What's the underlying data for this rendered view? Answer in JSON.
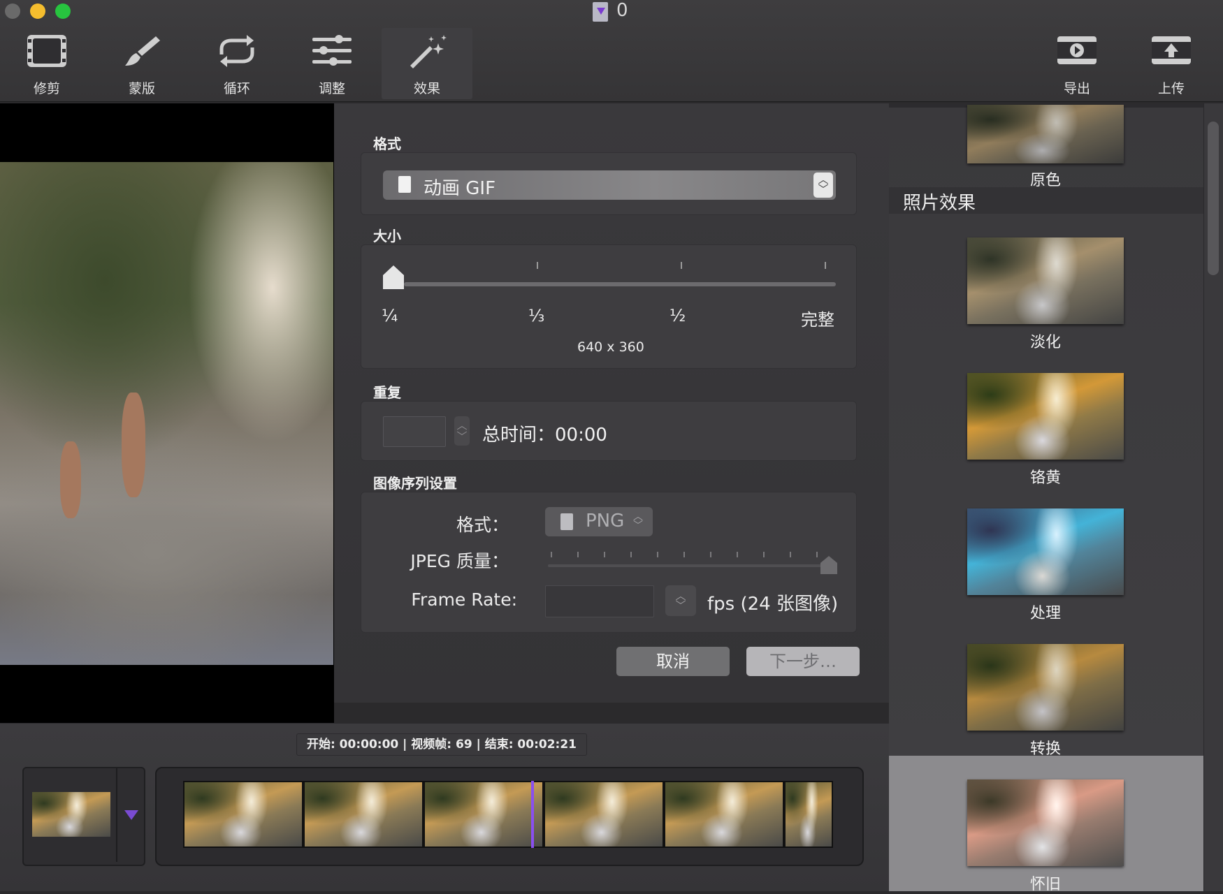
{
  "window": {
    "title": "0"
  },
  "toolbar": {
    "tools": [
      {
        "label": "修剪",
        "icon": "film-trim-icon"
      },
      {
        "label": "蒙版",
        "icon": "brush-icon"
      },
      {
        "label": "循环",
        "icon": "loop-arrows-icon"
      },
      {
        "label": "调整",
        "icon": "sliders-icon"
      },
      {
        "label": "效果",
        "icon": "magic-wand-icon"
      }
    ],
    "right_tools": [
      {
        "label": "导出",
        "icon": "film-play-icon"
      },
      {
        "label": "上传",
        "icon": "film-upload-icon"
      }
    ]
  },
  "dialog": {
    "format_label": "格式",
    "format_value": "动画 GIF",
    "size_label": "大小",
    "size_marks": [
      "¼",
      "⅓",
      "½",
      "完整"
    ],
    "size_dimensions": "640 x 360",
    "repeat_label": "重复",
    "total_time": "总时间：00:00",
    "sequence_label": "图像序列设置",
    "seq_format_label": "格式：",
    "seq_format_value": "PNG",
    "jpeg_quality_label": "JPEG 质量：",
    "jpeg_quality_level": 1.0,
    "frame_rate_label": "Frame Rate:",
    "fps_text": "fps (24 张图像)",
    "cancel_label": "取消",
    "next_label": "下一步…"
  },
  "timeline": {
    "timecode": "开始: 00:00:00 | 视频帧: 69 | 结束: 00:02:21"
  },
  "effects": {
    "top_item": "原色",
    "header": "照片效果",
    "items": [
      "淡化",
      "铬黄",
      "处理",
      "转换",
      "怀旧"
    ],
    "selected": "怀旧"
  },
  "colors": {
    "accent": "#8a4ff0",
    "window_bg": "#2b2a2c",
    "dialog_bg": "#363538"
  }
}
